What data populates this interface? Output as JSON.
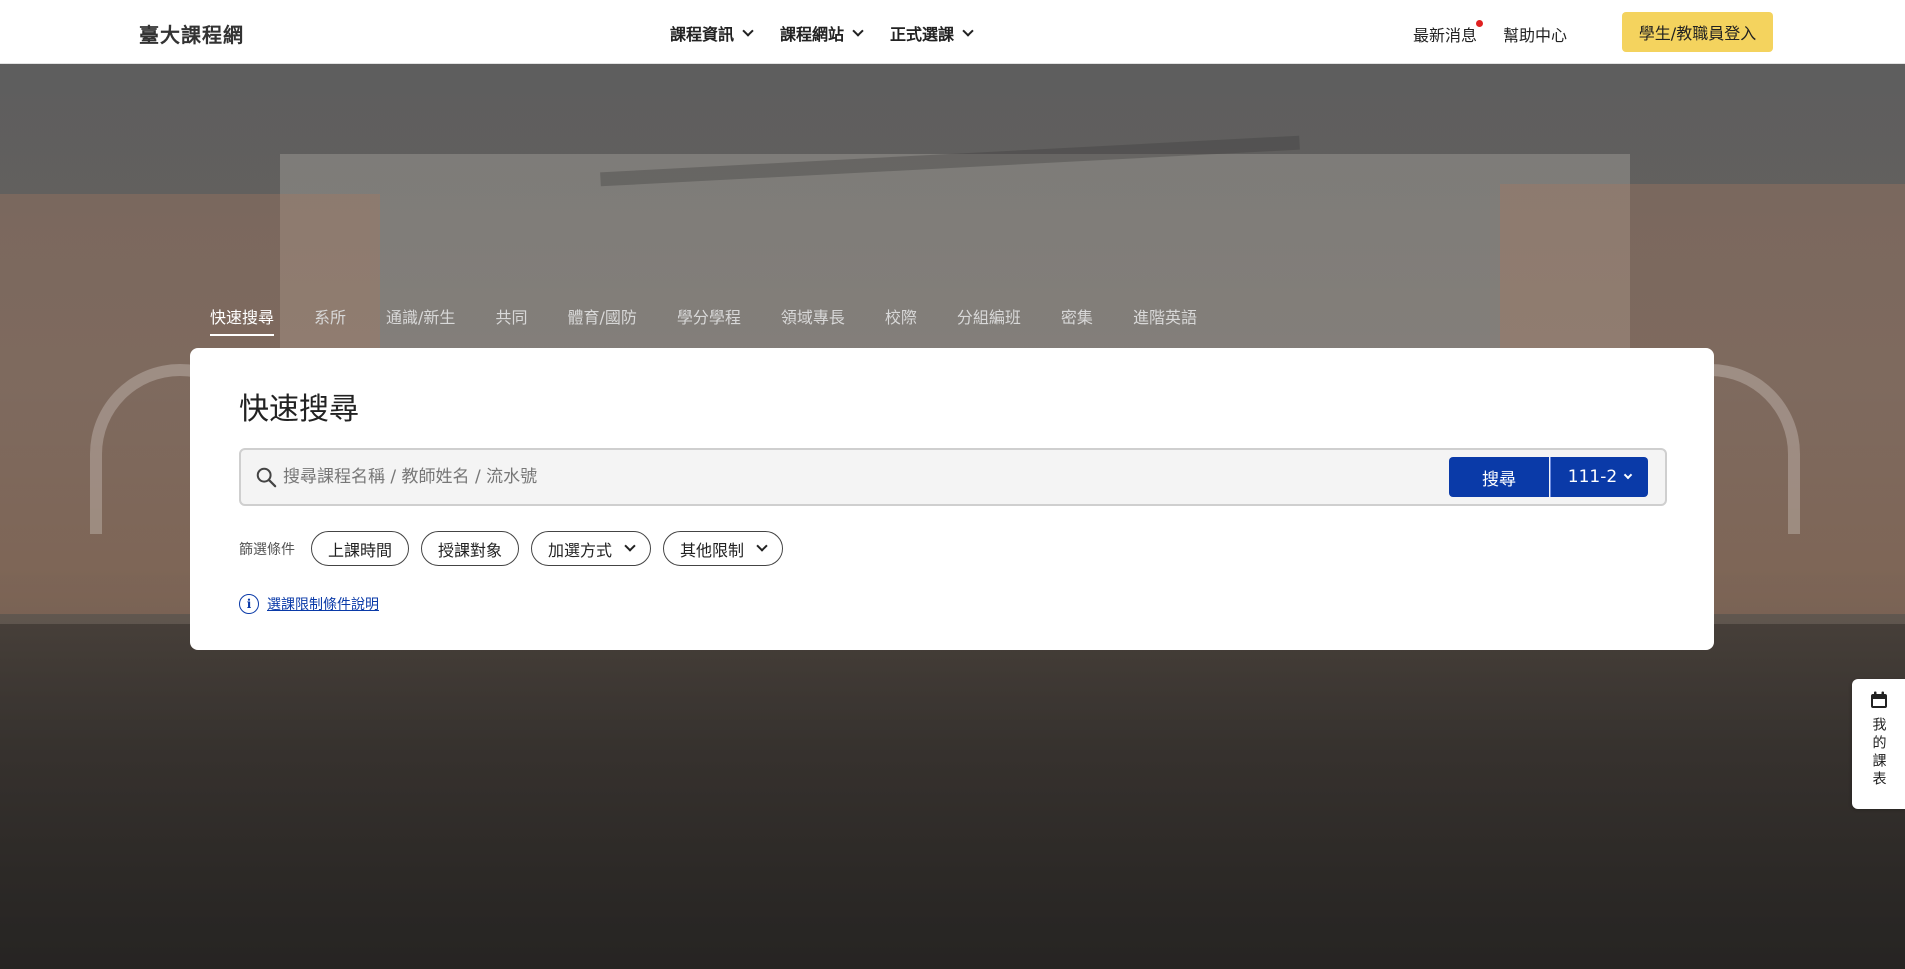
{
  "header": {
    "logo": "臺大課程網",
    "nav": [
      {
        "label": "課程資訊"
      },
      {
        "label": "課程網站"
      },
      {
        "label": "正式選課"
      }
    ],
    "news": "最新消息",
    "help": "幫助中心",
    "login": "學生/教職員登入"
  },
  "tabs": [
    {
      "label": "快速搜尋",
      "active": true
    },
    {
      "label": "系所"
    },
    {
      "label": "通識/新生"
    },
    {
      "label": "共同"
    },
    {
      "label": "體育/國防"
    },
    {
      "label": "學分學程"
    },
    {
      "label": "領域專長"
    },
    {
      "label": "校際"
    },
    {
      "label": "分組編班"
    },
    {
      "label": "密集"
    },
    {
      "label": "進階英語"
    }
  ],
  "card": {
    "title": "快速搜尋",
    "search": {
      "placeholder": "搜尋課程名稱 / 教師姓名 / 流水號",
      "value": "",
      "button": "搜尋",
      "term": "111-2"
    },
    "filters": {
      "label": "篩選條件",
      "chips": [
        "上課時間",
        "授課對象",
        "加選方式",
        "其他限制"
      ]
    },
    "info_link": "選課限制條件說明"
  },
  "side_tab": {
    "label": "我的課表"
  },
  "colors": {
    "primary": "#0a3aa8",
    "login": "#f4d35e",
    "alert_dot": "#e02020"
  }
}
